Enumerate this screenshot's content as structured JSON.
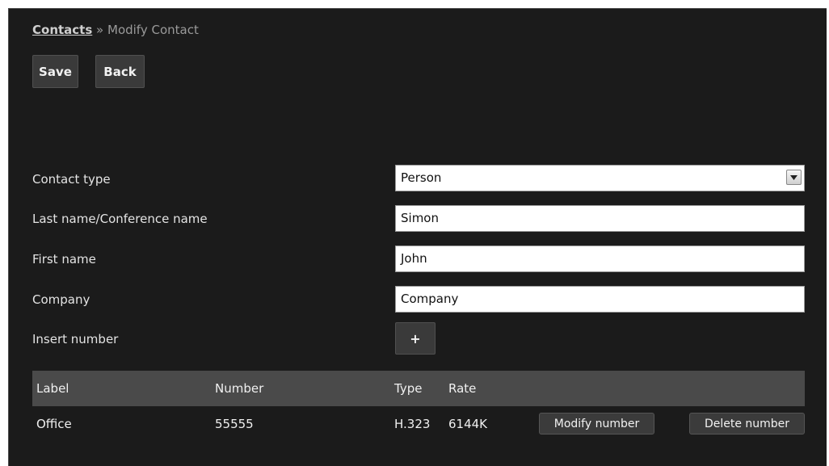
{
  "breadcrumb": {
    "root": "Contacts",
    "separator": " » ",
    "current": "Modify Contact"
  },
  "toolbar": {
    "save_label": "Save",
    "back_label": "Back"
  },
  "form": {
    "contact_type": {
      "label": "Contact type",
      "value": "Person"
    },
    "last_name": {
      "label": "Last name/Conference name",
      "value": "Simon"
    },
    "first_name": {
      "label": "First name",
      "value": "John"
    },
    "company": {
      "label": "Company",
      "value": "Company"
    },
    "insert_number": {
      "label": "Insert number",
      "button": "+"
    }
  },
  "numbers_table": {
    "headers": {
      "label": "Label",
      "number": "Number",
      "type": "Type",
      "rate": "Rate"
    },
    "rows": [
      {
        "label": "Office",
        "number": "55555",
        "type": "H.323",
        "rate": "6144K",
        "modify_label": "Modify number",
        "delete_label": "Delete number"
      }
    ]
  },
  "icons": {
    "select_arrow": "chevron-down-icon"
  }
}
